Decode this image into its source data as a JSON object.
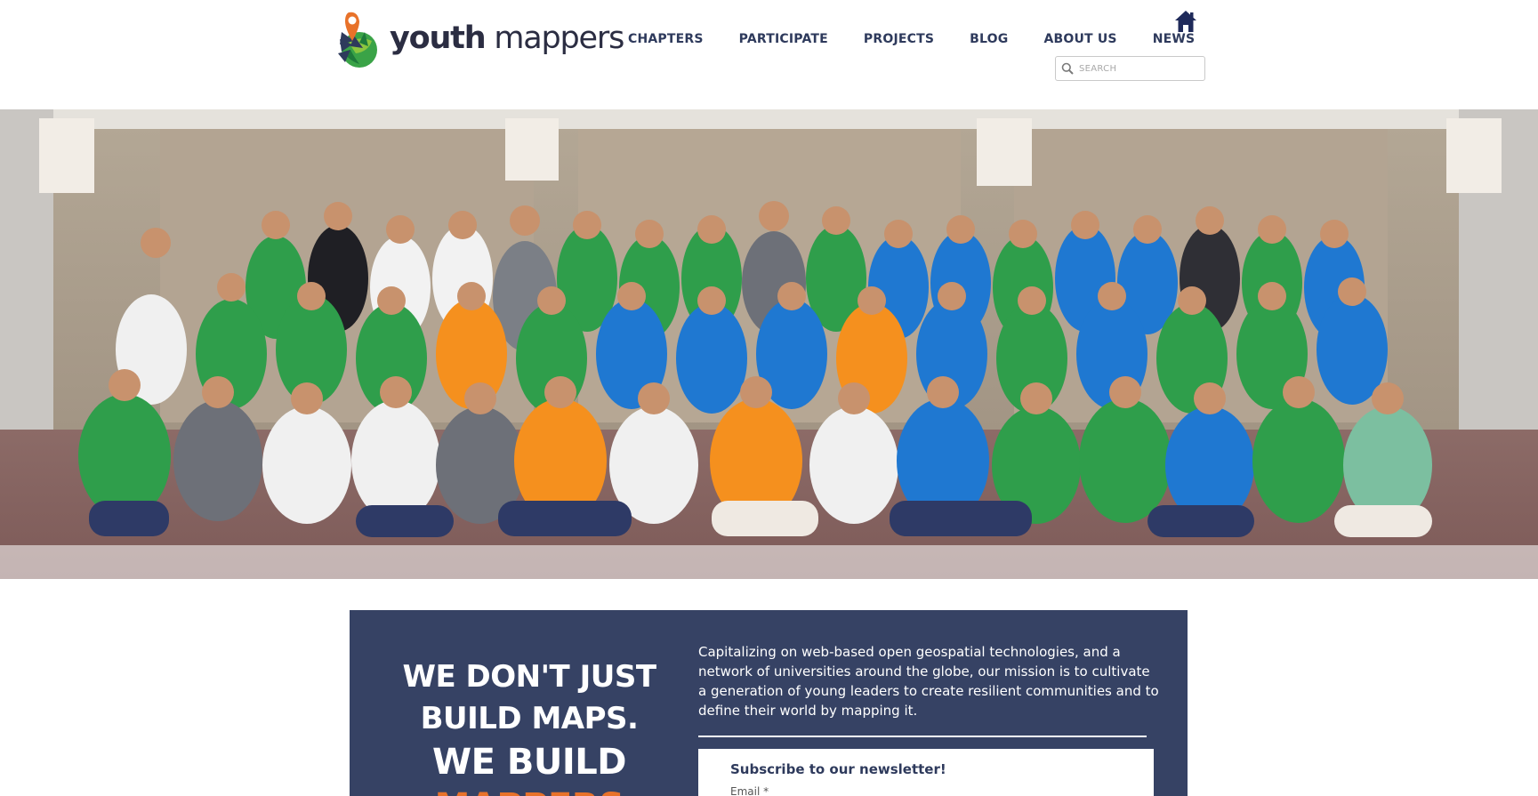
{
  "header": {
    "logo": {
      "bold_text": "youth",
      "light_text": "mappers"
    },
    "nav": [
      {
        "label": "CHAPTERS"
      },
      {
        "label": "PARTICIPATE"
      },
      {
        "label": "PROJECTS"
      },
      {
        "label": "BLOG"
      },
      {
        "label": "ABOUT US"
      },
      {
        "label": "NEWS"
      }
    ],
    "home_icon": "home-icon",
    "search": {
      "placeholder": "SEARCH",
      "icon": "search-icon"
    }
  },
  "hero": {
    "image": "group-photo"
  },
  "mission": {
    "headline": {
      "line1": "WE DON'T JUST",
      "line2": "BUILD MAPS.",
      "line3": "WE BUILD",
      "line4": "MAPPERS"
    },
    "text": "Capitalizing on web-based open geospatial technologies, and a network of universities around the globe, our mission is to cultivate a generation of young leaders to create resilient communities and to define their world by mapping it.",
    "subscribe": {
      "title": "Subscribe to our newsletter!",
      "email_label": "Email *"
    }
  },
  "colors": {
    "nav_text": "#2e3a5c",
    "panel_bg": "#364264",
    "accent_orange": "#e8722a",
    "logo_blue": "#2e3a5c",
    "logo_green": "#3aa347"
  }
}
